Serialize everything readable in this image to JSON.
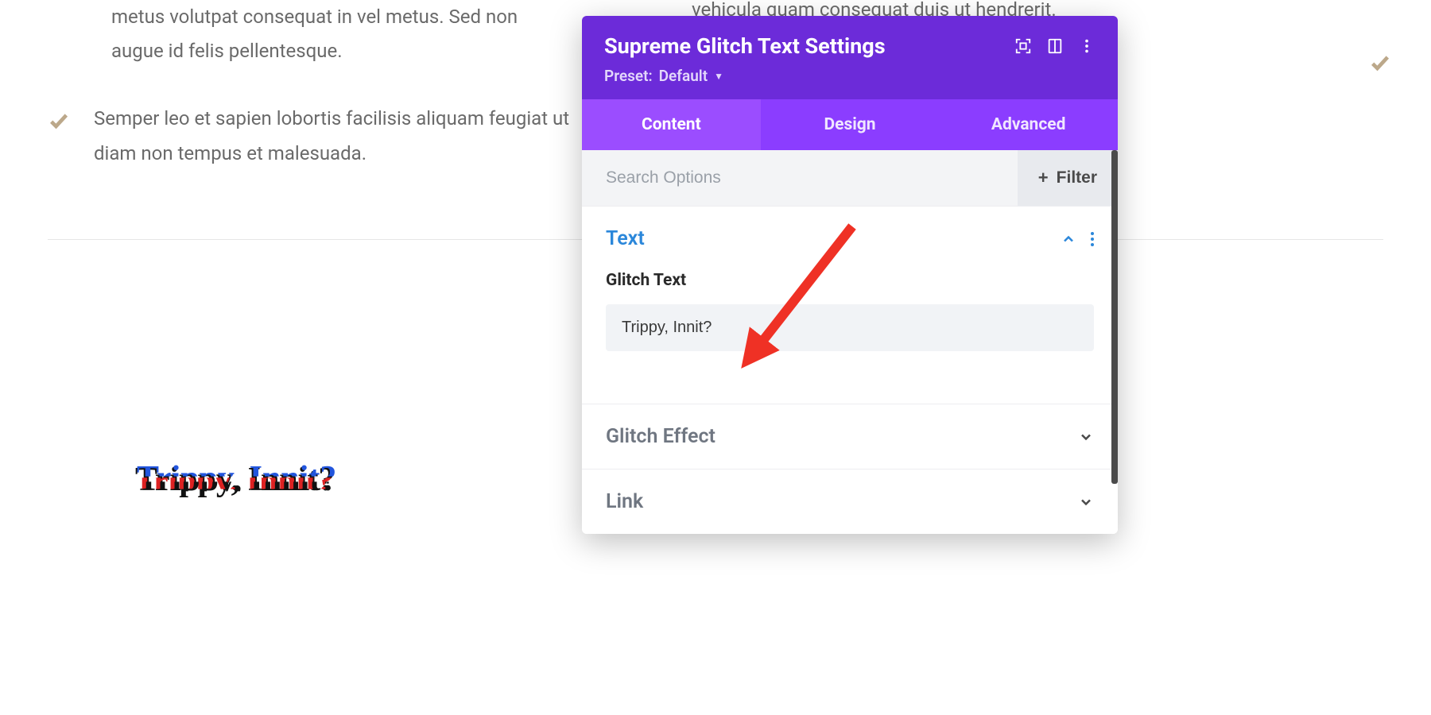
{
  "page": {
    "left_bullets": {
      "line1": "metus volutpat consequat in vel metus. Sed non",
      "line2": "augue id felis pellentesque.",
      "item2": "Semper leo et sapien lobortis facilisis aliquam feugiat ut diam non tempus et malesuada."
    },
    "right_text": "vehicula quam consequat duis ut hendrerit.",
    "preview_text": "Trippy, Innit?"
  },
  "panel": {
    "title": "Supreme Glitch Text Settings",
    "preset_label": "Preset:",
    "preset_value": "Default",
    "tabs": {
      "content": "Content",
      "design": "Design",
      "advanced": "Advanced"
    },
    "search_placeholder": "Search Options",
    "filter_label": "Filter",
    "sections": {
      "text": {
        "title": "Text",
        "field_label": "Glitch Text",
        "field_value": "Trippy, Innit?"
      },
      "glitch_effect": {
        "title": "Glitch Effect"
      },
      "link": {
        "title": "Link"
      }
    }
  },
  "colors": {
    "panel_header": "#6c2bd9",
    "tab_bar": "#8b3dff",
    "tab_active": "#9b4dff",
    "accent_blue": "#2b87da",
    "arrow": "#ef3125"
  }
}
